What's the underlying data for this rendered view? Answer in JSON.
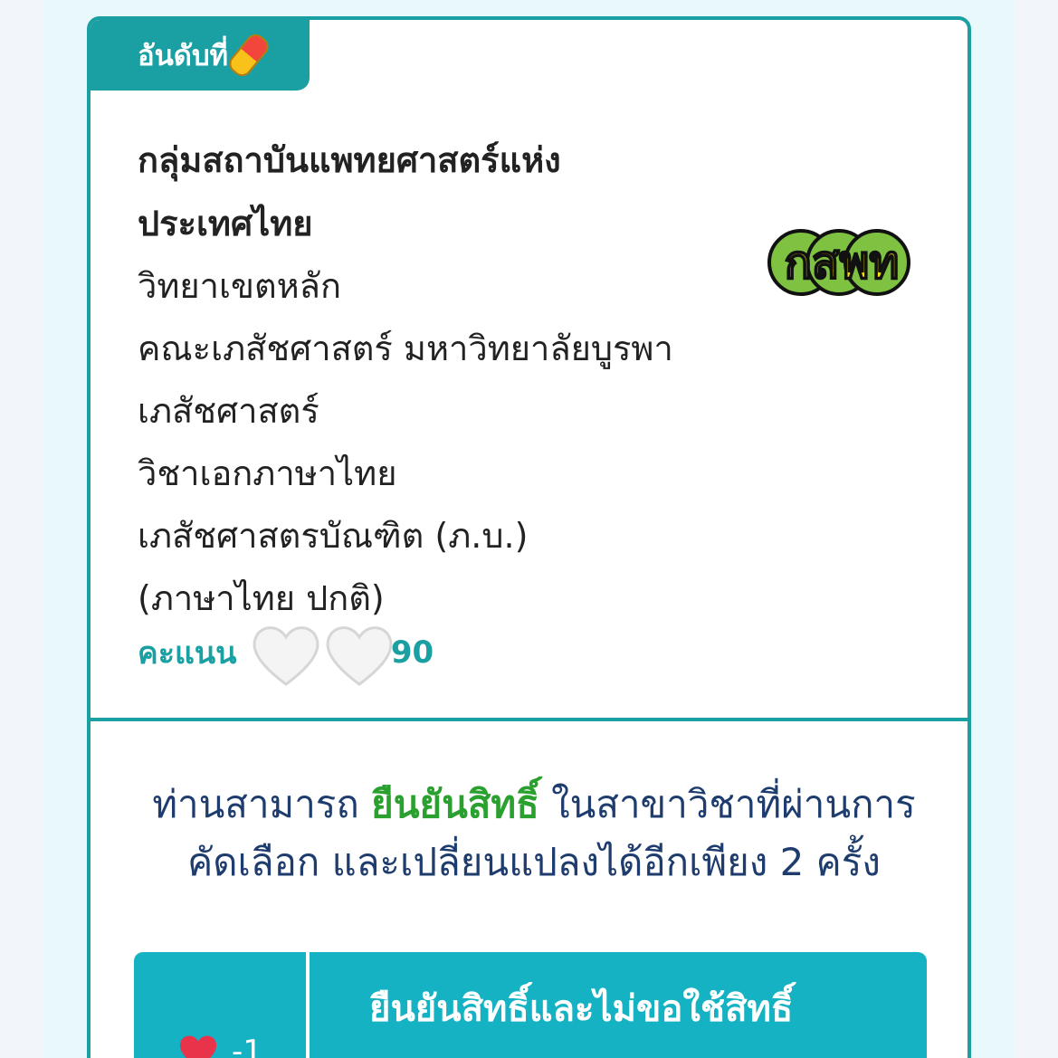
{
  "rank_tab": {
    "label": "อันดับที่",
    "icon": "pill-icon"
  },
  "program": {
    "institution_line1": "กลุ่มสถาบันแพทยศาสตร์แห่ง",
    "institution_line2": "ประเทศไทย",
    "campus": "วิทยาเขตหลัก",
    "faculty": "คณะเภสัชศาสตร์ มหาวิทยาลัยบูรพา",
    "department": "เภสัชศาสตร์",
    "major": "วิชาเอกภาษาไทย",
    "degree": "เภสัชศาสตรบัณฑิต (ภ.บ.)",
    "track": "(ภาษาไทย ปกติ)",
    "logo_text": "กสพท"
  },
  "score": {
    "label": "คะแนน",
    "max": "/90"
  },
  "notice": {
    "prefix": "ท่านสามารถ ",
    "highlight": "ยืนยันสิทธิ์",
    "suffix": " ในสาขาวิชาที่ผ่านการ",
    "line2": "คัดเลือก และเปลี่ยนแปลงได้อีกเพียง 2 ครั้ง"
  },
  "action": {
    "cost": "-1",
    "label": "ยืนยันสิทธิ์และไม่ขอใช้สิทธิ์"
  },
  "colors": {
    "teal": "#1a9fa2",
    "cyan_button": "#14b2c3",
    "highlight_green": "#2aa02e",
    "notice_blue": "#1e3d6e"
  }
}
